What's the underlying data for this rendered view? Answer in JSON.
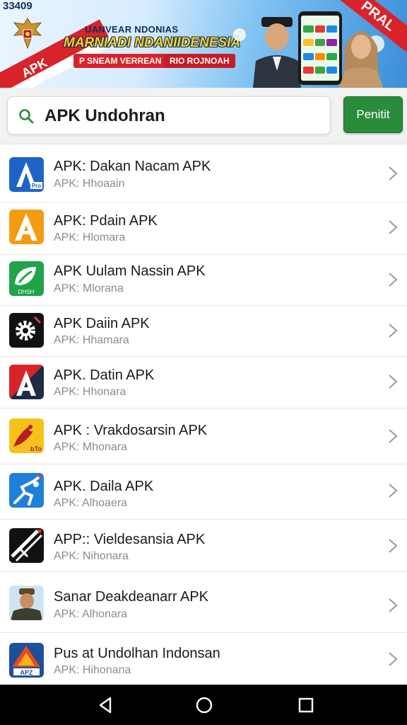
{
  "banner": {
    "status_time": "33409",
    "subtitle": "UANVEAR NDONIAS",
    "title": "MARNIADI NDANIIDENESIA",
    "pill_left": "P SNEAM VERREAN",
    "pill_right": "RIO ROJNOAH",
    "apk_tag": "APK",
    "corner_ribbon": "PRAL"
  },
  "search": {
    "query": "APK Undohran",
    "placeholder": "",
    "button_label": "Penitit"
  },
  "apps": [
    {
      "title": "APK: Dakan Nacam APK",
      "subtitle": "APK: Hhoaain",
      "icon": "letter-a-blue-icon"
    },
    {
      "title": "APK: Pdain APK",
      "subtitle": "APK: Hlomara",
      "icon": "letter-a-orange-icon"
    },
    {
      "title": "APK Uulam Nassin APK",
      "subtitle": "APK: Mlorana",
      "icon": "green-leaf-icon"
    },
    {
      "title": "APK Daiin APK",
      "subtitle": "APK: Hhamara",
      "icon": "gear-icon"
    },
    {
      "title": "APK. Datin APK",
      "subtitle": "APK: Hhonara",
      "icon": "letter-a-red-icon"
    },
    {
      "title": "APK : Vrakdosarsin APK",
      "subtitle": "APK: Mhonara",
      "icon": "eagle-icon"
    },
    {
      "title": "APK. Daila APK",
      "subtitle": "APK: Alhoaera",
      "icon": "runner-icon"
    },
    {
      "title": "APP:: Vieldesansia APK",
      "subtitle": "APK: Nihonara",
      "icon": "slash-logo-icon"
    },
    {
      "title": "Sanar Deakdeanarr APK",
      "subtitle": "APK: Alhonara",
      "icon": "officer-portrait-icon"
    },
    {
      "title": "Pus at Undolhan Indonsan",
      "subtitle": "APK: Hihonana",
      "icon": "triangle-logo-icon"
    }
  ],
  "colors": {
    "accent_green": "#2a8b3a",
    "banner_red": "#d8232a",
    "title_yellow": "#ffd21f"
  },
  "nav": {
    "back_icon": "back-triangle-icon",
    "home_icon": "home-circle-icon",
    "recent_icon": "recent-square-icon"
  }
}
